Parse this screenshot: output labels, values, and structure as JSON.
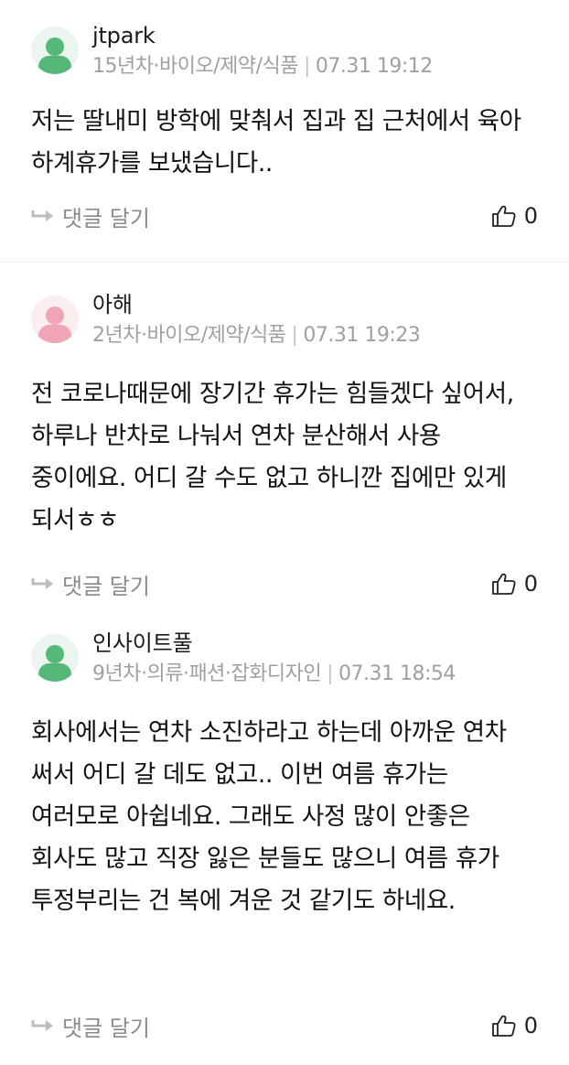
{
  "comments": [
    {
      "author": "jtpark",
      "career": "15년차·바이오/제약/식품",
      "timestamp": "07.31 19:12",
      "body": "저는 딸내미 방학에 맞춰서 집과 집 근처에서 육아 하계휴가를 보냈습니다..",
      "reply_label": "댓글 달기",
      "likes": "0",
      "avatar_color": "#55b879"
    },
    {
      "author": "아해",
      "career": "2년차·바이오/제약/식품",
      "timestamp": "07.31 19:23",
      "body": "전 코로나때문에 장기간 휴가는 힘들겠다 싶어서, 하루나 반차로 나눠서 연차 분산해서 사용 중이에요. 어디 갈 수도 없고 하니깐 집에만 있게 되서ㅎㅎ",
      "reply_label": "댓글 달기",
      "likes": "0",
      "avatar_color": "#efa5b6"
    },
    {
      "author": "인사이트풀",
      "career": "9년차·의류·패션·잡화디자인",
      "timestamp": "07.31 18:54",
      "body": "회사에서는 연차 소진하라고 하는데 아까운 연차 써서 어디 갈 데도 없고.. 이번 여름 휴가는 여러모로 아쉽네요. 그래도 사정 많이 안좋은 회사도 많고 직장 잃은 분들도 많으니 여름 휴가 투정부리는 건 복에 겨운 것 같기도 하네요.",
      "reply_label": "댓글 달기",
      "likes": "0",
      "avatar_color": "#55b879"
    }
  ],
  "icons": {
    "avatar": "user-avatar-icon",
    "reply": "reply-arrow-icon",
    "like": "thumbs-up-icon"
  }
}
